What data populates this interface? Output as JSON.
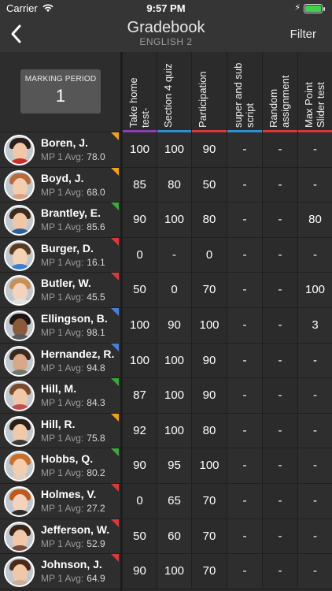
{
  "status": {
    "carrier": "Carrier",
    "time": "9:57 PM"
  },
  "nav": {
    "title": "Gradebook",
    "subtitle": "ENGLISH 2",
    "filter_label": "Filter"
  },
  "marking_period": {
    "label": "MARKING PERIOD",
    "value": "1"
  },
  "columns": [
    {
      "title": "Take home test-",
      "color": "#8a3fb7"
    },
    {
      "title": "Section 4 quiz",
      "color": "#2d8fd1"
    },
    {
      "title": "Participation",
      "color": "#d63a3a"
    },
    {
      "title": "super and sub script",
      "color": "#2d8fd1"
    },
    {
      "title": "Random assignment",
      "color": "#d63a3a"
    },
    {
      "title": "Max Point Slider test",
      "color": "#d63a3a"
    }
  ],
  "avg_prefix": "MP 1 Avg:",
  "students": [
    {
      "name": "Boren, J.",
      "avg": "78.0",
      "flag": "#f0a020",
      "scores": [
        "100",
        "100",
        "90",
        "-",
        "-",
        "-"
      ],
      "hair": "#2a1f1a",
      "skin": "#f0c8a8",
      "shirt": "#c9302c"
    },
    {
      "name": "Boyd, J.",
      "avg": "68.0",
      "flag": "#f0a020",
      "scores": [
        "85",
        "80",
        "50",
        "-",
        "-",
        "-"
      ],
      "hair": "#b86b3a",
      "skin": "#f2cdb0",
      "shirt": "#d8a080"
    },
    {
      "name": "Brantley, E.",
      "avg": "85.6",
      "flag": "#3aa83a",
      "scores": [
        "90",
        "100",
        "80",
        "-",
        "-",
        "80"
      ],
      "hair": "#3b2a1e",
      "skin": "#efc7a6",
      "shirt": "#2f5fa0"
    },
    {
      "name": "Burger, D.",
      "avg": "16.1",
      "flag": "#d63a3a",
      "scores": [
        "0",
        "-",
        "0",
        "-",
        "-",
        "-"
      ],
      "hair": "#5a3a22",
      "skin": "#f3d2b6",
      "shirt": "#3a7fd0"
    },
    {
      "name": "Butler, W.",
      "avg": "45.5",
      "flag": "#d63a3a",
      "scores": [
        "50",
        "0",
        "70",
        "-",
        "-",
        "100"
      ],
      "hair": "#c89058",
      "skin": "#f3d3bd",
      "shirt": "#e0e0e0"
    },
    {
      "name": "Ellingson, B.",
      "avg": "98.1",
      "flag": "#4a7fd6",
      "scores": [
        "100",
        "90",
        "100",
        "-",
        "-",
        "3"
      ],
      "hair": "#1e1410",
      "skin": "#8a5a3a",
      "shirt": "#5a5a5a"
    },
    {
      "name": "Hernandez, R.",
      "avg": "94.8",
      "flag": "#4a7fd6",
      "scores": [
        "100",
        "100",
        "90",
        "-",
        "-",
        "-"
      ],
      "hair": "#3a2a1e",
      "skin": "#d8a888",
      "shirt": "#6a7a6a"
    },
    {
      "name": "Hill, M.",
      "avg": "84.3",
      "flag": "#3aa83a",
      "scores": [
        "87",
        "100",
        "90",
        "-",
        "-",
        "-"
      ],
      "hair": "#7a4a2a",
      "skin": "#f0c8a8",
      "shirt": "#c05050"
    },
    {
      "name": "Hill, R.",
      "avg": "75.8",
      "flag": "#f0a020",
      "scores": [
        "92",
        "100",
        "80",
        "-",
        "-",
        "-"
      ],
      "hair": "#2a1e16",
      "skin": "#f0caa8",
      "shirt": "#3a3a3a"
    },
    {
      "name": "Hobbs, Q.",
      "avg": "80.2",
      "flag": "#3aa83a",
      "scores": [
        "90",
        "95",
        "100",
        "-",
        "-",
        "-"
      ],
      "hair": "#c8702a",
      "skin": "#f2cdb0",
      "shirt": "#e0d0c0"
    },
    {
      "name": "Holmes, V.",
      "avg": "27.2",
      "flag": "#d63a3a",
      "scores": [
        "0",
        "65",
        "70",
        "-",
        "-",
        "-"
      ],
      "hair": "#c05a1a",
      "skin": "#f3d3bd",
      "shirt": "#2a2a2a"
    },
    {
      "name": "Jefferson, W.",
      "avg": "52.9",
      "flag": "#d63a3a",
      "scores": [
        "50",
        "60",
        "70",
        "-",
        "-",
        "-"
      ],
      "hair": "#3a2416",
      "skin": "#f0c8a8",
      "shirt": "#7a4a3a"
    },
    {
      "name": "Johnson, J.",
      "avg": "64.9",
      "flag": "#d63a3a",
      "scores": [
        "90",
        "100",
        "70",
        "-",
        "-",
        "-"
      ],
      "hair": "#4a2a1a",
      "skin": "#f0c8a8",
      "shirt": "#c9b09a"
    }
  ]
}
